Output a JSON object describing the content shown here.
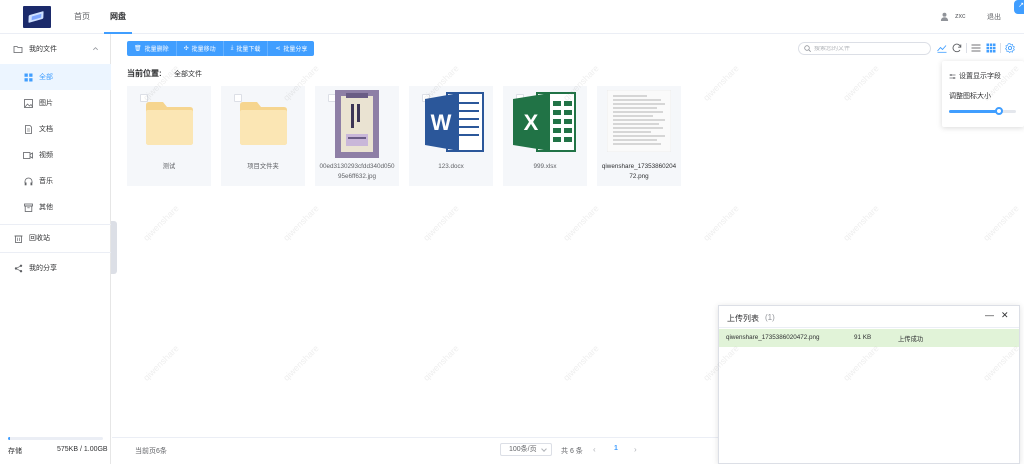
{
  "header": {
    "nav": [
      "首页",
      "网盘"
    ],
    "username": "zxc",
    "logout_label": "退出"
  },
  "sidebar": {
    "my_files": "我的文件",
    "items": [
      {
        "label": "全部",
        "icon": "grid-icon"
      },
      {
        "label": "图片",
        "icon": "image-icon"
      },
      {
        "label": "文档",
        "icon": "document-icon"
      },
      {
        "label": "视频",
        "icon": "video-icon"
      },
      {
        "label": "音乐",
        "icon": "headphones-icon"
      },
      {
        "label": "其他",
        "icon": "box-icon"
      }
    ],
    "recycle": "回收站",
    "share": "我的分享",
    "storage_label": "存储",
    "storage_value": "575KB / 1.00GB",
    "storage_fraction": 0.0006
  },
  "toolbar": {
    "buttons": [
      {
        "label": "批量删除",
        "icon": "trash-icon"
      },
      {
        "label": "批量移动",
        "icon": "move-icon"
      },
      {
        "label": "批量下载",
        "icon": "download-icon"
      },
      {
        "label": "批量分享",
        "icon": "share-icon"
      }
    ],
    "search_placeholder": "搜索您的文件"
  },
  "breadcrumb": {
    "label": "当前位置:",
    "value": "全部文件"
  },
  "files": [
    {
      "name": "测试",
      "type": "folder",
      "checked": false
    },
    {
      "name": "项目文件夹",
      "type": "folder",
      "checked": false
    },
    {
      "name": "00ed3130293cfdd340d05095e6ff632.jpg",
      "type": "image",
      "checked": false
    },
    {
      "name": "123.docx",
      "type": "word",
      "checked": false
    },
    {
      "name": "999.xlsx",
      "type": "excel",
      "checked": false
    },
    {
      "name": "qiwenshare_1735386020472.png",
      "type": "document-image",
      "checked": true
    }
  ],
  "popover": {
    "set_fields": "设置显示字段",
    "icon_size": "调整图标大小",
    "icon_size_fraction": 0.75
  },
  "footer": {
    "current_page_count": "当前页6条",
    "page_size": "100条/页",
    "total": "共 6 条",
    "prev": "‹",
    "current_page": "1",
    "next": "›"
  },
  "upload": {
    "title": "上传列表",
    "count": "(1)",
    "minimize": "—",
    "close": "✕",
    "rows": [
      {
        "file": "qiwenshare_1735386020472.png",
        "size": "91 KB",
        "status": "上传成功"
      }
    ]
  },
  "watermark_text": "qiwenshare",
  "colors": {
    "primary": "#409eff",
    "success_row": "#e1f3d8",
    "folder": "#f8dfa3",
    "word": "#2b579a",
    "excel": "#217346"
  }
}
